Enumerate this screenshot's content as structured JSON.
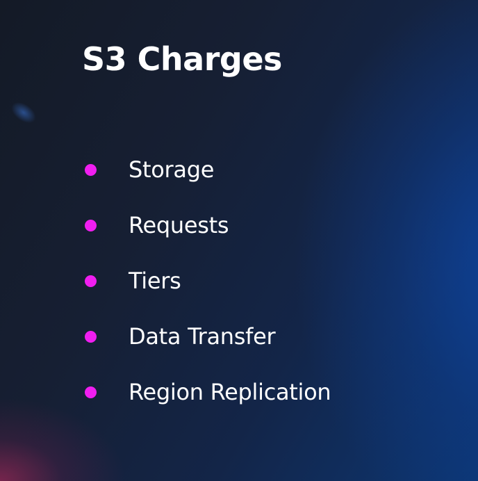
{
  "slide": {
    "title": "S3 Charges",
    "bullet_color": "#f01ef0",
    "bullets": [
      {
        "label": "Storage"
      },
      {
        "label": "Requests"
      },
      {
        "label": "Tiers"
      },
      {
        "label": "Data Transfer"
      },
      {
        "label": "Region Replication"
      }
    ]
  }
}
